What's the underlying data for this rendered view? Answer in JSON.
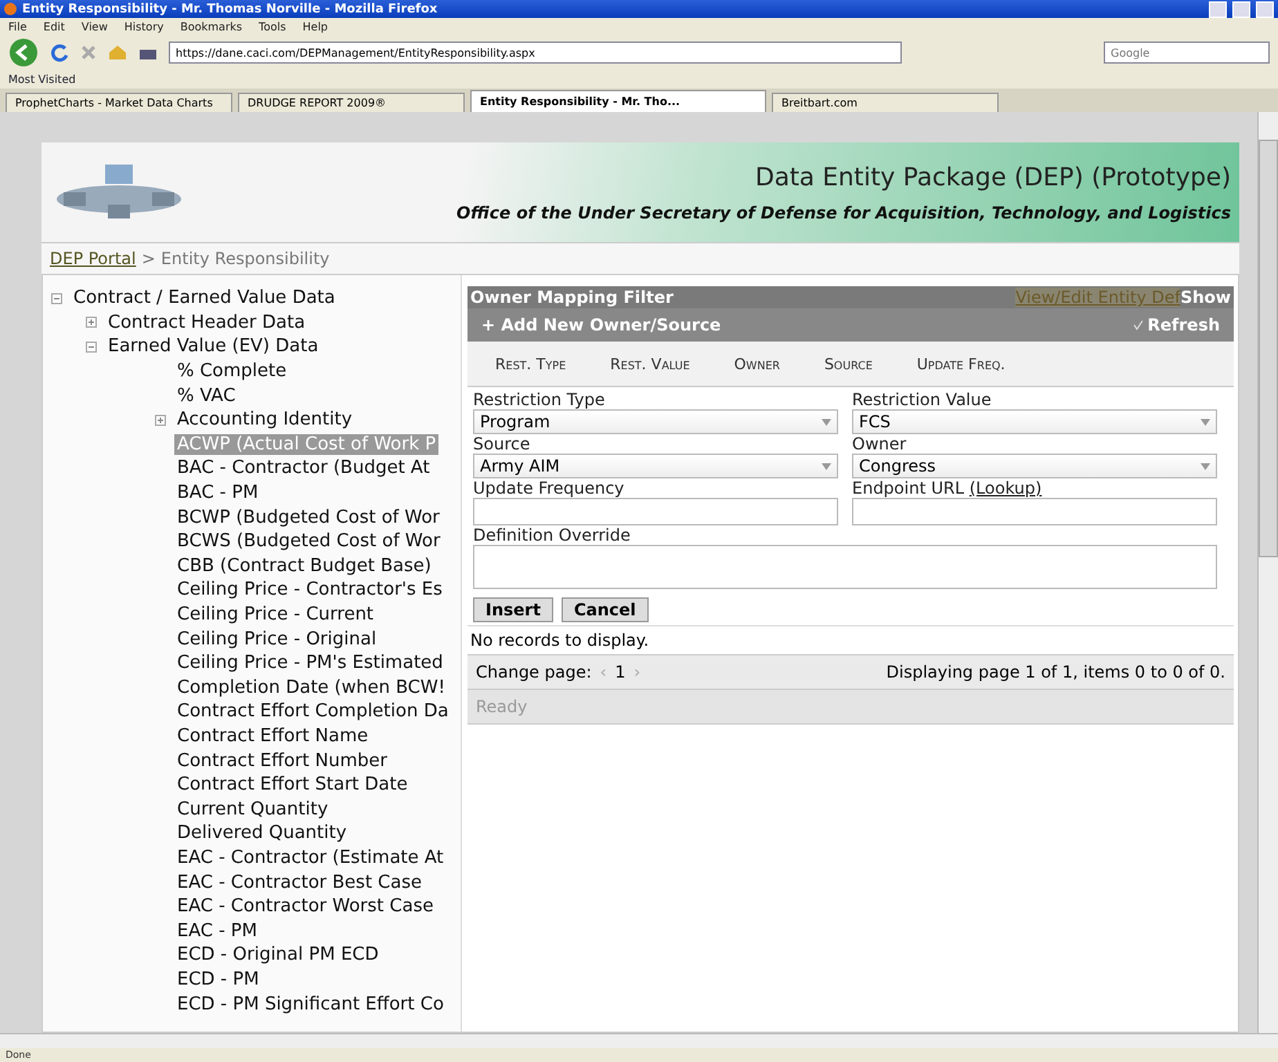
{
  "window": {
    "title": "Entity Responsibility - Mr. Thomas Norville - Mozilla Firefox"
  },
  "menu": [
    "File",
    "Edit",
    "View",
    "History",
    "Bookmarks",
    "Tools",
    "Help"
  ],
  "address": {
    "value": "https://dane.caci.com/DEPManagement/EntityResponsibility.aspx"
  },
  "search": {
    "placeholder": "Google"
  },
  "bookmarks": [
    "Most Visited"
  ],
  "tabs": [
    {
      "label": "ProphetCharts - Market Data Charts",
      "selected": false
    },
    {
      "label": "DRUDGE REPORT 2009®",
      "selected": false
    },
    {
      "label": "Entity Responsibility - Mr. Tho...",
      "selected": true
    },
    {
      "label": "Breitbart.com",
      "selected": false
    }
  ],
  "header": {
    "title": "Data Entity Package (DEP) (Prototype)",
    "subtitle": "Office of the Under Secretary of Defense for Acquisition, Technology, and Logistics"
  },
  "breadcrumb": {
    "link": "DEP Portal",
    "separator": ">",
    "current": "Entity Responsibility"
  },
  "tree": [
    {
      "label": "Contract / Earned Value Data",
      "expanded": true,
      "selected": false,
      "children": [
        {
          "label": "Contract Header Data",
          "expanded": false,
          "selected": false
        },
        {
          "label": "Earned Value (EV) Data",
          "expanded": true,
          "selected": false,
          "children": [
            {
              "label": "% Complete",
              "selected": false
            },
            {
              "label": "% VAC",
              "selected": false
            },
            {
              "label": "Accounting Identity",
              "expanded": false,
              "selected": false
            },
            {
              "label": "ACWP (Actual Cost of Work P",
              "selected": true
            },
            {
              "label": "BAC - Contractor (Budget At",
              "selected": false
            },
            {
              "label": "BAC - PM",
              "selected": false
            },
            {
              "label": "BCWP (Budgeted Cost of Wor",
              "selected": false
            },
            {
              "label": "BCWS (Budgeted Cost of Wor",
              "selected": false
            },
            {
              "label": "CBB (Contract Budget Base)",
              "selected": false
            },
            {
              "label": "Ceiling Price - Contractor's Es",
              "selected": false
            },
            {
              "label": "Ceiling Price - Current",
              "selected": false
            },
            {
              "label": "Ceiling Price - Original",
              "selected": false
            },
            {
              "label": "Ceiling Price - PM's Estimated",
              "selected": false
            },
            {
              "label": "Completion Date (when BCW!",
              "selected": false
            },
            {
              "label": "Contract Effort Completion Da",
              "selected": false
            },
            {
              "label": "Contract Effort Name",
              "selected": false
            },
            {
              "label": "Contract Effort Number",
              "selected": false
            },
            {
              "label": "Contract Effort Start Date",
              "selected": false
            },
            {
              "label": "Current Quantity",
              "selected": false
            },
            {
              "label": "Delivered Quantity",
              "selected": false
            },
            {
              "label": "EAC - Contractor (Estimate At",
              "selected": false
            },
            {
              "label": "EAC - Contractor Best Case",
              "selected": false
            },
            {
              "label": "EAC - Contractor Worst Case",
              "selected": false
            },
            {
              "label": "EAC - PM",
              "selected": false
            },
            {
              "label": "ECD - Original PM ECD",
              "selected": false
            },
            {
              "label": "ECD - PM",
              "selected": false
            },
            {
              "label": "ECD - PM Significant Effort Co",
              "selected": false
            }
          ]
        }
      ]
    }
  ],
  "panel": {
    "title": "Owner Mapping Filter",
    "link": "View/Edit Entity Def",
    "toggle": "Show",
    "add": "+ Add New Owner/Source",
    "refresh": "Refresh",
    "columns": [
      "Rest. Type",
      "Rest. Value",
      "Owner",
      "Source",
      "Update Freq."
    ],
    "fields": [
      {
        "label": "Restriction Type",
        "kind": "select",
        "value": "Program"
      },
      {
        "label": "Restriction Value",
        "kind": "select",
        "value": "FCS"
      },
      {
        "label": "Source",
        "kind": "combo",
        "value": "Army AIM"
      },
      {
        "label": "Owner",
        "kind": "select",
        "value": "Congress"
      },
      {
        "label": "Update Frequency",
        "kind": "text"
      },
      {
        "label": "Endpoint URL",
        "link": "(Lookup)",
        "kind": "text"
      },
      {
        "label": "Definition Override",
        "kind": "area"
      }
    ],
    "buttons": [
      "Insert",
      "Cancel"
    ],
    "empty": "No records to display.",
    "pager": {
      "label": "Change page:",
      "prev": "‹",
      "page": "1",
      "next": "›",
      "info": "Displaying page 1 of 1, items 0 to 0 of 0."
    },
    "status": "Ready"
  },
  "status_bar": "Done"
}
